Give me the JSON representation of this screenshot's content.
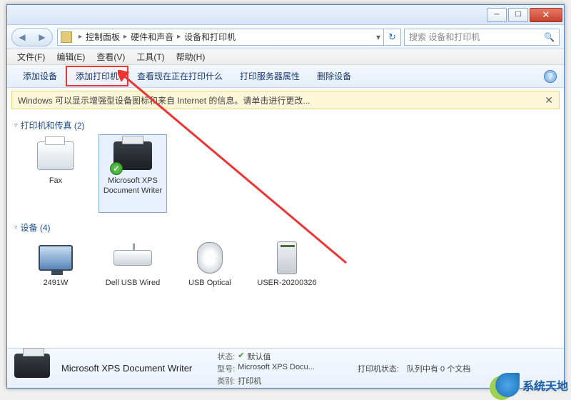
{
  "breadcrumb": {
    "root_icon": "folder",
    "items": [
      "控制面板",
      "硬件和声音",
      "设备和打印机"
    ]
  },
  "search": {
    "placeholder": "搜索 设备和打印机"
  },
  "menus": {
    "file": "文件(F)",
    "edit": "编辑(E)",
    "view": "查看(V)",
    "tools": "工具(T)",
    "help": "帮助(H)"
  },
  "toolbar": {
    "add_device": "添加设备",
    "add_printer": "添加打印机",
    "view_printing": "查看现在正在打印什么",
    "print_server_props": "打印服务器属性",
    "remove_device": "删除设备"
  },
  "infobar": {
    "text": "Windows 可以显示增强型设备图标和来自 Internet 的信息。请单击进行更改..."
  },
  "groups": {
    "printers": {
      "title": "打印机和传真 (2)",
      "items": [
        {
          "key": "fax",
          "label": "Fax"
        },
        {
          "key": "xps",
          "label": "Microsoft XPS Document Writer",
          "selected": true,
          "default_check": true
        }
      ]
    },
    "devices": {
      "title": "设备 (4)",
      "items": [
        {
          "key": "monitor",
          "label": "2491W"
        },
        {
          "key": "keyboard",
          "label": "Dell USB Wired"
        },
        {
          "key": "mouse",
          "label": "USB Optical"
        },
        {
          "key": "computer",
          "label": "USER-20200326"
        }
      ]
    }
  },
  "details": {
    "name": "Microsoft XPS Document Writer",
    "status_label": "状态:",
    "status_value": "默认值",
    "model_label": "型号:",
    "model_value": "Microsoft XPS Docu...",
    "category_label": "类别:",
    "category_value": "打印机",
    "queue_label": "打印机状态:",
    "queue_value": "队列中有 0 个文档"
  },
  "watermark": "系统天地"
}
